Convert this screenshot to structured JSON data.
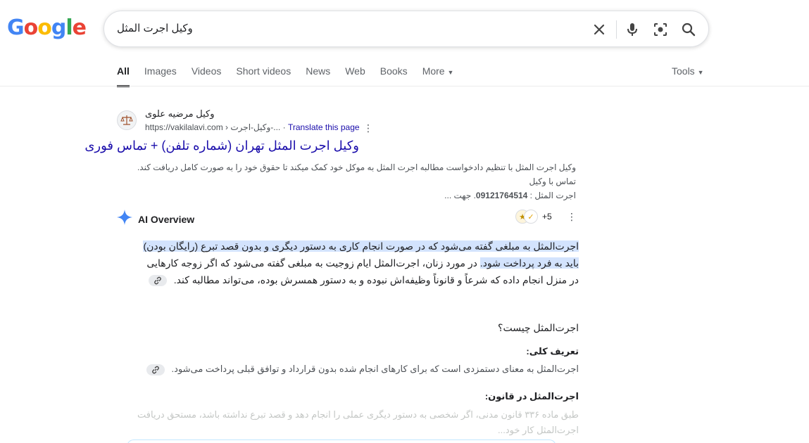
{
  "logo": {
    "letters": [
      "G",
      "o",
      "o",
      "g",
      "l",
      "e"
    ],
    "colors": [
      "#4285f4",
      "#ea4335",
      "#fbbc05",
      "#4285f4",
      "#34a853",
      "#ea4335"
    ]
  },
  "search": {
    "query": "وکیل اجرت المثل"
  },
  "icons": {
    "clear": "close-icon",
    "mic": "microphone-icon",
    "lens": "camera-lens-icon",
    "search": "search-icon"
  },
  "tabs": [
    {
      "label": "All",
      "active": true
    },
    {
      "label": "Images"
    },
    {
      "label": "Videos"
    },
    {
      "label": "Short videos"
    },
    {
      "label": "News"
    },
    {
      "label": "Web"
    },
    {
      "label": "Books"
    },
    {
      "label": "More"
    }
  ],
  "tools_label": "Tools",
  "result": {
    "site_name": "وکیل مرضیه علوی",
    "url": "https://vakilalavi.com › وکیل-اجرت-...",
    "translate": "Translate this page",
    "title": "وکیل اجرت المثل تهران (شماره تلفن) + تماس فوری",
    "snippet_line1": "وکیل اجرت المثل با تنظیم دادخواست مطالبه اجرت المثل به موکل خود کمک میکند تا حقوق خود را به صورت کامل دریافت کند. تماس با وکیل",
    "snippet_line2_pre": "اجرت المثل : ",
    "snippet_phone": "09121764514",
    "snippet_line2_post": ". جهت ..."
  },
  "ai_overview": {
    "label": "AI Overview",
    "source_count": "+5",
    "para_highlight": "اجرت‌المثل به مبلغی گفته می‌شود که در صورت انجام کاری به دستور دیگری و بدون قصد تبرع (رایگان بودن) باید به فرد پرداخت شود.",
    "para_rest": " در مورد زنان، اجرت‌المثل ایام زوجیت به مبلغی گفته می‌شود که اگر زوجه کارهایی در منزل انجام داده که شرعاً و قانوناً وظیفه‌اش نبوده و به دستور همسرش بوده، می‌تواند مطالبه کند.",
    "heading1": "اجرت‌المثل چیست؟",
    "sub1": "تعریف کلی:",
    "def1": "اجرت‌المثل به معنای دستمزدی است که برای کارهای انجام شده بدون قرارداد و توافق قبلی پرداخت می‌شود.",
    "sub2": "اجرت‌المثل در قانون:",
    "law_line1": "طبق ماده ۳۳۶ قانون مدنی، اگر شخصی به دستور دیگری عملی را انجام دهد و قصد تبرع نداشته باشد، مستحق دریافت",
    "law_line2": "اجرت‌المثل کار خود..."
  }
}
